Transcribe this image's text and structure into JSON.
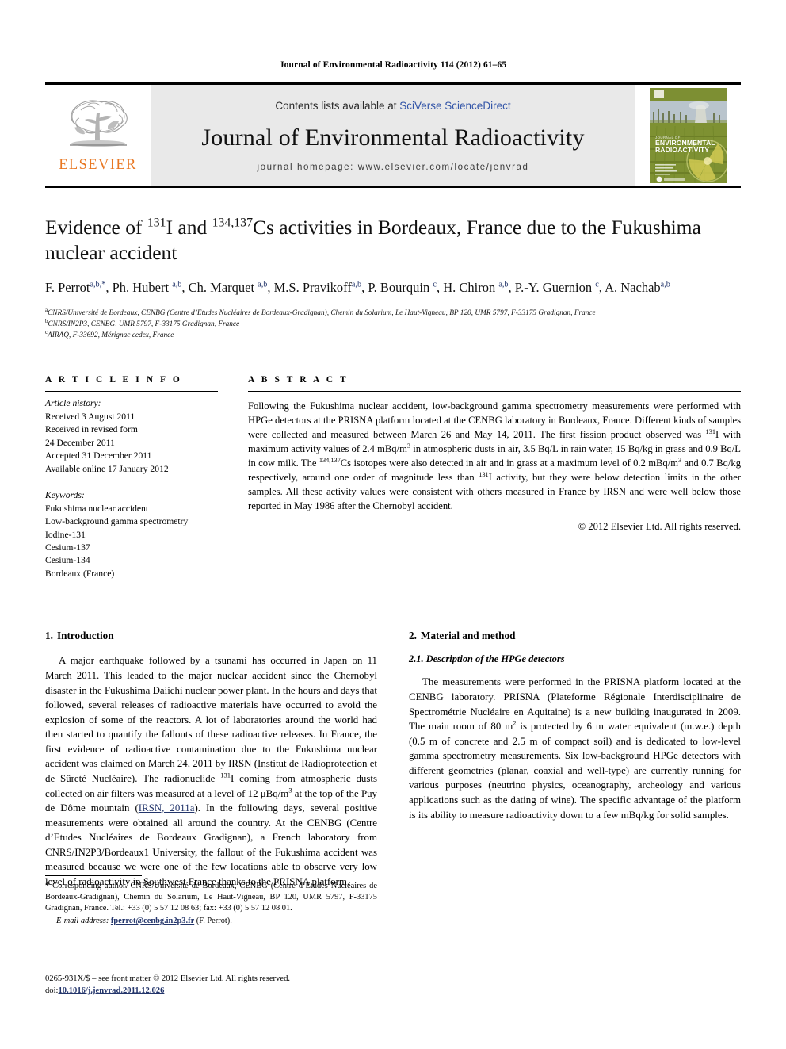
{
  "running_head": "Journal of Environmental Radioactivity 114 (2012) 61–65",
  "masthead": {
    "contents_prefix": "Contents lists available at ",
    "contents_link": "SciVerse ScienceDirect",
    "journal_title": "Journal of Environmental Radioactivity",
    "homepage": "journal homepage: www.elsevier.com/locate/jenvrad",
    "publisher_wordmark": "ELSEVIER",
    "publisher_color": "#E87722",
    "link_color": "#3355a8",
    "cover": {
      "line1": "JOURNAL OF",
      "line2": "ENVIRONMENTAL",
      "line3": "RADIOACTIVITY"
    }
  },
  "article": {
    "title_part1": "Evidence of ",
    "title_sup1": "131",
    "title_part2": "I and ",
    "title_sup2": "134,137",
    "title_part3": "Cs activities in Bordeaux, France due to the Fukushima nuclear accident",
    "authors": [
      {
        "name": "F. Perrot",
        "sup": "a,b,*",
        "sep": ", "
      },
      {
        "name": "Ph. Hubert ",
        "sup": "a,b",
        "sep": ", "
      },
      {
        "name": "Ch. Marquet ",
        "sup": "a,b",
        "sep": ", "
      },
      {
        "name": "M.S. Pravikoff",
        "sup": "a,b",
        "sep": ", "
      },
      {
        "name": "P. Bourquin ",
        "sup": "c",
        "sep": ", "
      },
      {
        "name": "H. Chiron ",
        "sup": "a,b",
        "sep": ", "
      },
      {
        "name": "P.-Y. Guernion ",
        "sup": "c",
        "sep": ", "
      },
      {
        "name": "A. Nachab",
        "sup": "a,b",
        "sep": ""
      }
    ],
    "affiliations": [
      {
        "marker": "a",
        "text": "CNRS/Université de Bordeaux, CENBG (Centre d’Etudes Nucléaires de Bordeaux-Gradignan), Chemin du Solarium, Le Haut-Vigneau, BP 120, UMR 5797, F-33175 Gradignan, France"
      },
      {
        "marker": "b",
        "text": "CNRS/IN2P3, CENBG, UMR 5797, F-33175 Gradignan, France"
      },
      {
        "marker": "c",
        "text": "AIRAQ, F-33692, Mérignac cedex, France"
      }
    ]
  },
  "article_info": {
    "heading": "A R T I C L E  I N F O",
    "history_heading": "Article history:",
    "history": [
      "Received 3 August 2011",
      "Received in revised form",
      "24 December 2011",
      "Accepted 31 December 2011",
      "Available online 17 January 2012"
    ],
    "keywords_heading": "Keywords:",
    "keywords": [
      "Fukushima nuclear accident",
      "Low-background gamma spectrometry",
      "Iodine-131",
      "Cesium-137",
      "Cesium-134",
      "Bordeaux (France)"
    ]
  },
  "abstract": {
    "heading": "A B S T R A C T",
    "p1": "Following the Fukushima nuclear accident, low-background gamma spectrometry measurements were performed with HPGe detectors at the PRISNA platform located at the CENBG laboratory in Bordeaux, France. Different kinds of samples were collected and measured between March 26 and May 14, 2011. The first fission product observed was ",
    "sup1": "131",
    "p2": "I with maximum activity values of 2.4 mBq/m",
    "sup2": "3",
    "p3": " in atmospheric dusts in air, 3.5 Bq/L in rain water, 15 Bq/kg in grass and 0.9 Bq/L in cow milk. The ",
    "sup3": "134,137",
    "p4": "Cs isotopes were also detected in air and in grass at a maximum level of 0.2 mBq/m",
    "sup4": "3",
    "p5": " and 0.7 Bq/kg respectively, around one order of magnitude less than ",
    "sup5": "131",
    "p6": "I activity, but they were below detection limits in the other samples. All these activity values were consistent with others measured in France by IRSN and were well below those reported in May 1986 after the Chernobyl accident.",
    "copyright": "© 2012 Elsevier Ltd. All rights reserved."
  },
  "sections": {
    "intro_num": "1.",
    "intro_title": "Introduction",
    "intro_p1_a": "A major earthquake followed by a tsunami has occurred in Japan on 11 March 2011. This leaded to the major nuclear accident since the Chernobyl disaster in the Fukushima Daiichi nuclear power plant. In the hours and days that followed, several releases of radioactive materials have occurred to avoid the explosion of some of the reactors. A lot of laboratories around the world had then started to quantify the fallouts of these radioactive releases. In France, the first evidence of radioactive contamination due to the Fukushima nuclear accident was claimed on March 24, 2011 by IRSN (Institut de Radioprotection et de Sûreté Nucléaire). The radionuclide ",
    "intro_sup1": "131",
    "intro_p1_b": "I coming from atmospheric dusts collected on air filters was measured at a level of 12 μBq/m",
    "intro_sup2": "3",
    "intro_p1_c": " at the top of the Puy de Dôme mountain (",
    "intro_link": "IRSN, 2011a",
    "intro_p1_d": "). In the following days, several positive measurements were obtained all around the country. At the CENBG (Centre d’Etudes Nucléaires de Bordeaux Gradignan), a French laboratory from CNRS/IN2P3/Bordeaux1 University, the fallout of the Fukushima accident was measured because we were one of the few locations able to observe very low level of radioactivity in Southwest France thanks to the PRISNA platform.",
    "method_num": "2.",
    "method_title": "Material and method",
    "sub_num": "2.1.",
    "sub_title": "Description of the HPGe detectors",
    "sub_p1_a": "The measurements were performed in the PRISNA platform located at the CENBG laboratory. PRISNA (Plateforme Régionale Interdisciplinaire de Spectrométrie Nucléaire en Aquitaine) is a new building inaugurated in 2009. The main room of 80 m",
    "sub_sup1": "2",
    "sub_p1_b": " is protected by 6 m water equivalent (m.w.e.) depth (0.5 m of concrete and 2.5 m of compact soil) and is dedicated to low-level gamma spectrometry measurements. Six low-background HPGe detectors with different geometries (planar, coaxial and well-type) are currently running for various purposes (neutrino physics, oceanography, archeology and various applications such as the dating of wine). The specific advantage of the platform is its ability to measure radioactivity down to a few mBq/kg for solid samples."
  },
  "footnote": {
    "star": "*",
    "text": " Corresponding author. CNRS/Université de Bordeaux, CENBG (Centre d’Etudes Nucléaires de Bordeaux-Gradignan), Chemin du Solarium, Le Haut-Vigneau, BP 120, UMR 5797, F-33175 Gradignan, France. Tel.: +33 (0) 5 57 12 08 63; fax: +33 (0) 5 57 12 08 01.",
    "email_label": "E-mail address:",
    "email": "fperrot@cenbg.in2p3.fr",
    "email_owner": "(F. Perrot)."
  },
  "issn": {
    "line1": "0265-931X/$ – see front matter © 2012 Elsevier Ltd. All rights reserved.",
    "doi_label": "doi:",
    "doi": "10.1016/j.jenvrad.2011.12.026"
  }
}
